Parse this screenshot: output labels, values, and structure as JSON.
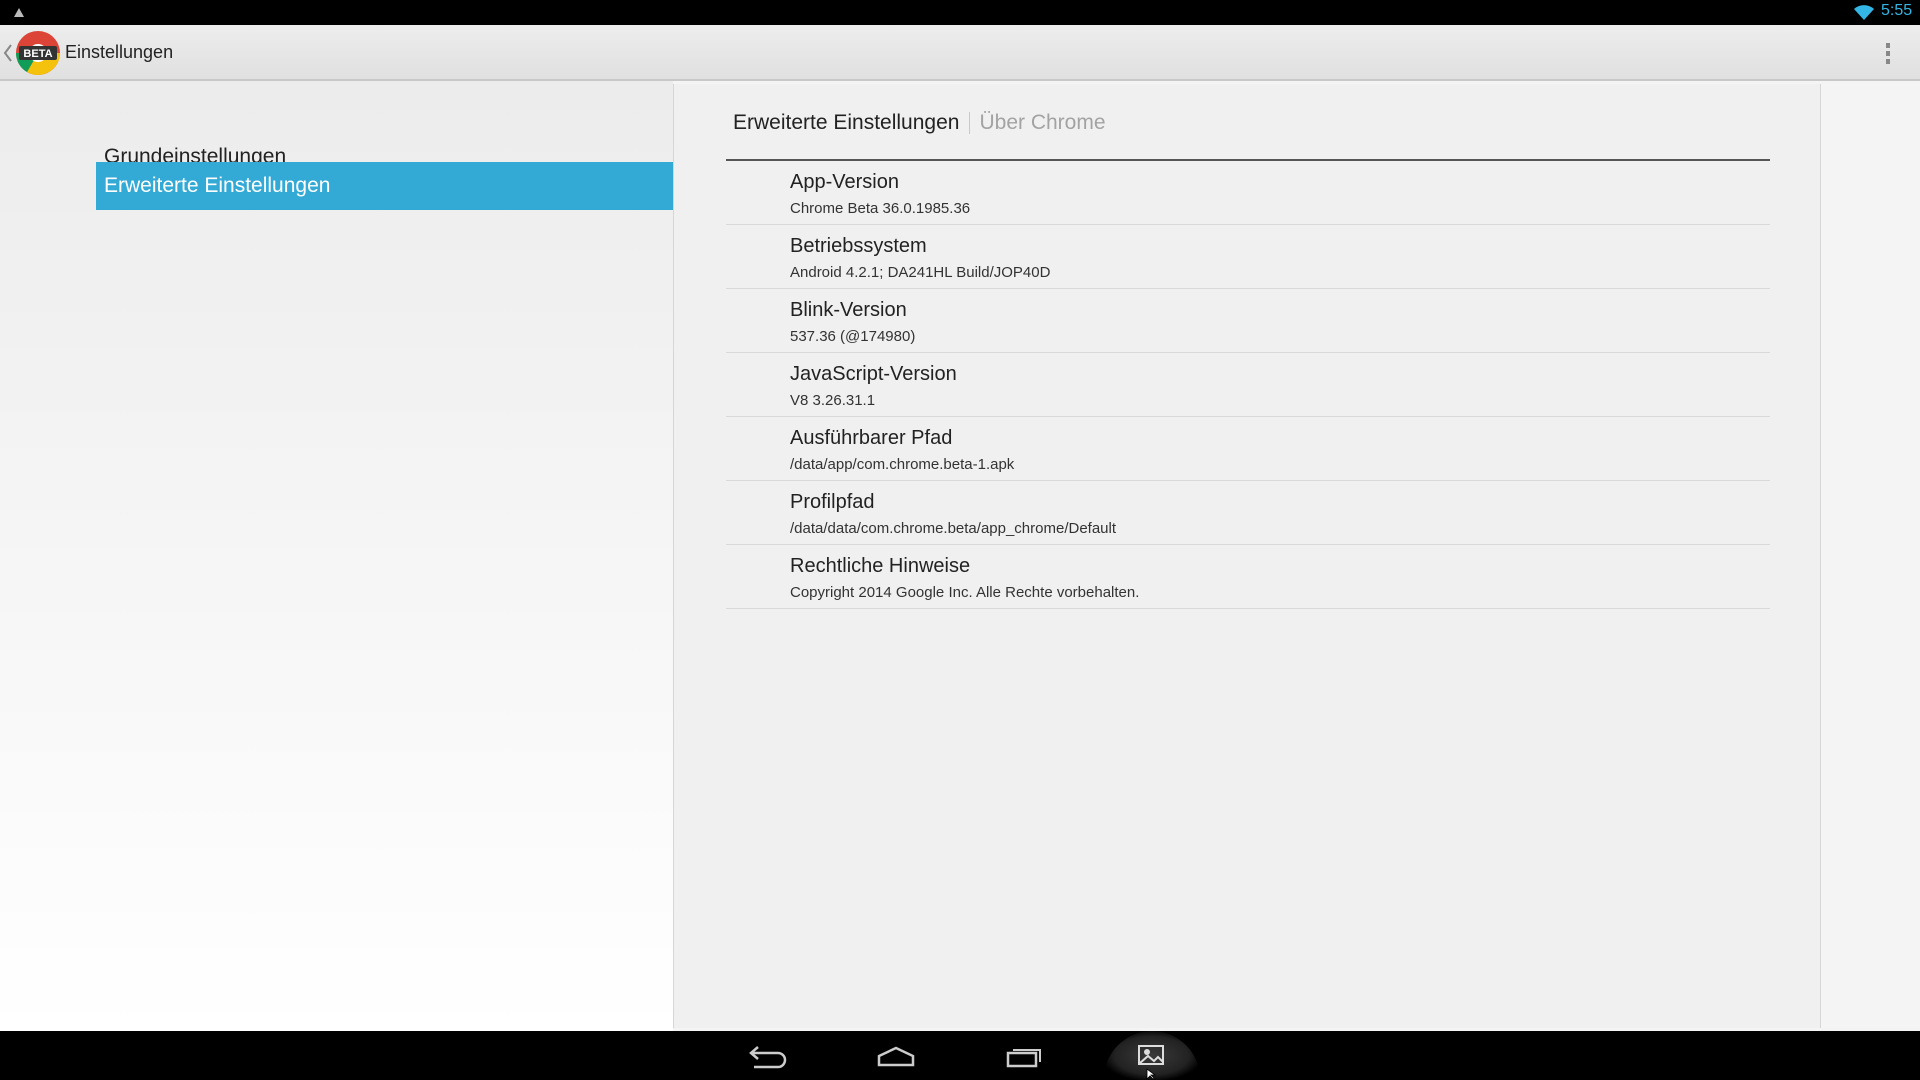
{
  "status_bar": {
    "time": "5:55",
    "accent_color": "#33b5e5",
    "icons": [
      "notification-icon",
      "wifi-icon"
    ]
  },
  "action_bar": {
    "logo_badge": "BETA",
    "title": "Einstellungen",
    "overflow_icon": "overflow-menu-icon"
  },
  "headers": [
    {
      "label": "Grundeinstellungen",
      "selected": false
    },
    {
      "label": "Erweiterte Einstellungen",
      "selected": true
    }
  ],
  "detail": {
    "breadcrumb": {
      "current": "Erweiterte Einstellungen",
      "parent": "Über Chrome"
    },
    "items": [
      {
        "title": "App-Version",
        "summary": "Chrome Beta 36.0.1985.36"
      },
      {
        "title": "Betriebssystem",
        "summary": "Android 4.2.1; DA241HL Build/JOP40D"
      },
      {
        "title": "Blink-Version",
        "summary": "537.36 (@174980)"
      },
      {
        "title": "JavaScript-Version",
        "summary": "V8 3.26.31.1"
      },
      {
        "title": "Ausführbarer Pfad",
        "summary": "/data/app/com.chrome.beta-1.apk"
      },
      {
        "title": "Profilpfad",
        "summary": "/data/data/com.chrome.beta/app_chrome/Default"
      },
      {
        "title": "Rechtliche Hinweise",
        "summary": "Copyright 2014 Google Inc. Alle Rechte vorbehalten."
      }
    ]
  },
  "nav_bar": {
    "buttons": [
      "back-icon",
      "home-icon",
      "recent-apps-icon",
      "screenshot-icon"
    ]
  },
  "colors": {
    "selected_header": "#33a9d6",
    "breadcrumb_parent": "#a3a3a3"
  }
}
